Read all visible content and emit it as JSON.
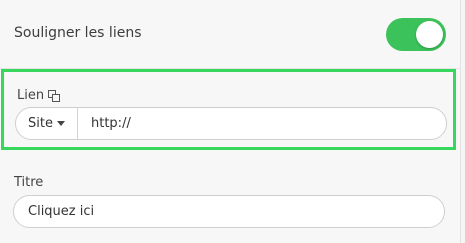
{
  "underline": {
    "label": "Souligner les liens",
    "toggle_on": true,
    "toggle_color": "#3cc25a"
  },
  "link": {
    "label": "Lien",
    "label_icon": "copy-icon",
    "type_selected": "Site",
    "url_value": "http://",
    "highlight_color": "#37d65c"
  },
  "title": {
    "label": "Titre",
    "value": "Cliquez ici"
  }
}
